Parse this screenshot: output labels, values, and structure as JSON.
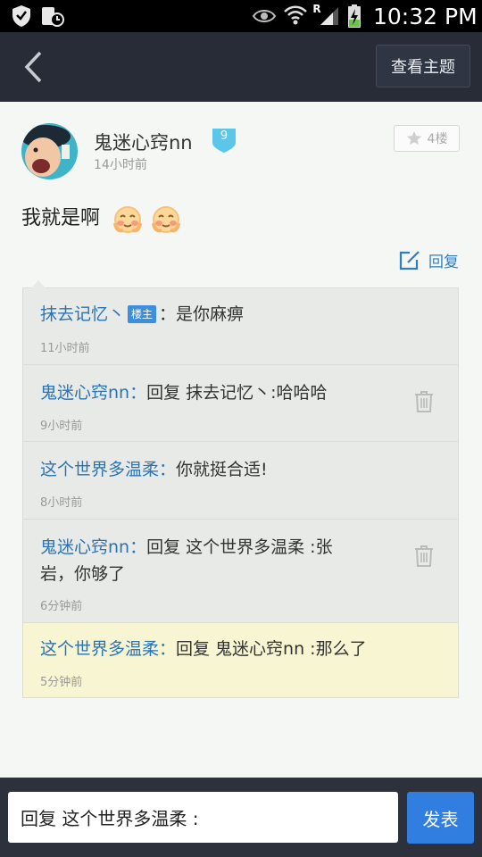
{
  "status_bar": {
    "time": "10:32 PM",
    "roaming": "R"
  },
  "header": {
    "view_topic_label": "查看主题"
  },
  "post": {
    "username": "鬼迷心窍nn",
    "level": "9",
    "time": "14小时前",
    "floor": "4楼",
    "text": "我就是啊",
    "reply_label": "回复"
  },
  "comments": [
    {
      "name": "抹去记忆丶",
      "tag": "楼主",
      "sep": "：",
      "text": "是你麻痹",
      "time": "11小时前",
      "deletable": false
    },
    {
      "name": "鬼迷心窍nn：",
      "text": "回复 抹去记忆丶:哈哈哈",
      "time": "9小时前",
      "deletable": true
    },
    {
      "name": "这个世界多温柔：",
      "text": "你就挺合适!",
      "time": "8小时前",
      "deletable": false
    },
    {
      "name": "鬼迷心窍nn：",
      "text": "回复 这个世界多温柔 :张",
      "text2": "岩，你够了",
      "time": "6分钟前",
      "deletable": true
    },
    {
      "name": "这个世界多温柔：",
      "text": "回复 鬼迷心窍nn :那么了",
      "time": "5分钟前",
      "deletable": false
    }
  ],
  "reply_bar": {
    "input_value": "回复 这个世界多温柔 :",
    "send_label": "发表"
  },
  "colors": {
    "accent": "#2f7ee0",
    "header_bg": "#272c36",
    "link": "#2b73b4",
    "highlight": "#f7f5d2"
  }
}
